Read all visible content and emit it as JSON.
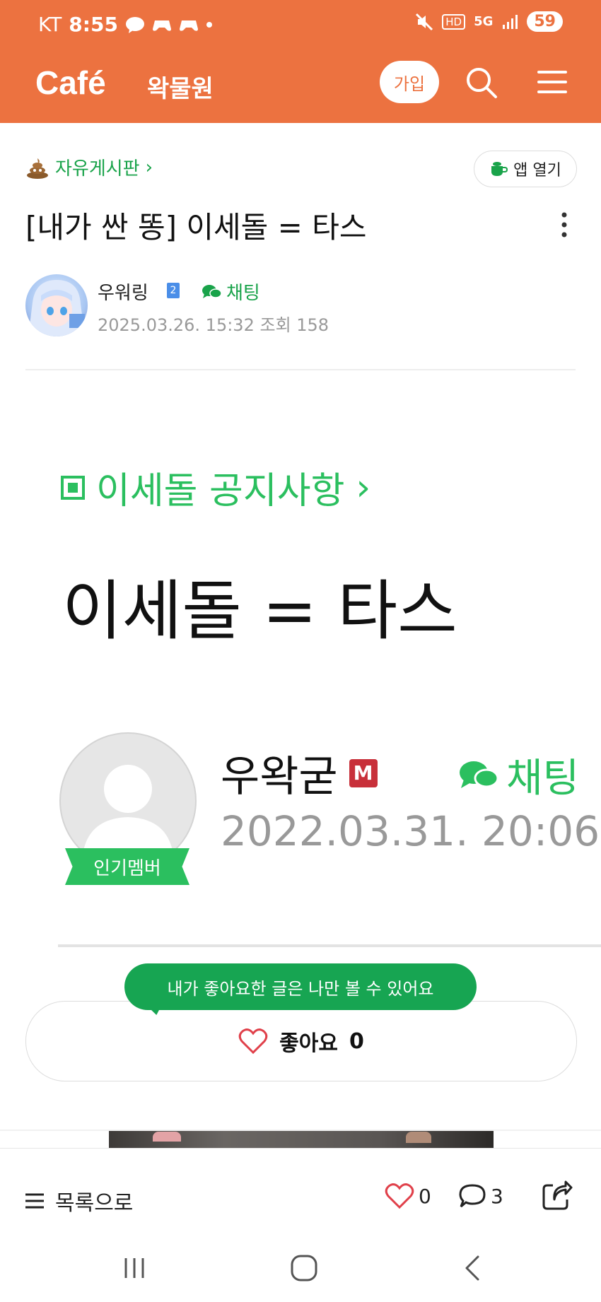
{
  "status_bar": {
    "carrier": "KT",
    "time": "8:55",
    "hd": "HD",
    "network": "5G",
    "battery": "59"
  },
  "header": {
    "logo": "Café",
    "cafe_name": "왁물원",
    "join_label": "가입"
  },
  "post": {
    "board": "자유게시판",
    "board_chevron": "›",
    "app_open_label": "앱 열기",
    "title": "[내가 싼 똥] 이세돌 = 타스",
    "author": "우워링",
    "author_level": "2",
    "chat_label": "채팅",
    "date": "2025.03.26. 15:32",
    "views_label": "조회 158"
  },
  "embedded_image": {
    "board": "이세돌 공지사항",
    "board_chevron": "›",
    "title": "이세돌 = 타스",
    "author": "우왁굳",
    "author_badge": "M",
    "chat_label": "채팅",
    "date": "2022.03.31. 20:06",
    "popular_badge": "인기멤버"
  },
  "like": {
    "tooltip": "내가 좋아요한 글은 나만 볼 수 있어요",
    "label": "좋아요",
    "count": "0"
  },
  "bottom_bar": {
    "list_label": "목록으로",
    "like_count": "0",
    "comment_count": "3"
  },
  "colors": {
    "brand_orange": "#ec7240",
    "accent_green": "#19a34a",
    "heart_red": "#e0404a"
  }
}
